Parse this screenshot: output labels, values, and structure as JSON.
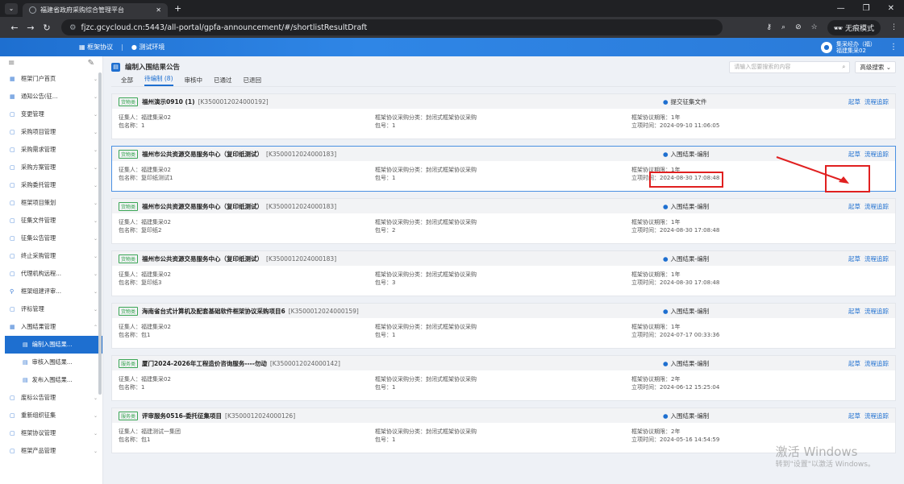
{
  "browser": {
    "tab_title": "福建省政府采购综合管理平台",
    "site_icon": "tune-icon",
    "url": "fjzc.gcycloud.cn:5443/all-portal/gpfa-announcement/#/shortlistResultDraft",
    "incognito_label": "无痕模式"
  },
  "appbar": {
    "item1": "框架协议",
    "item2": "测试环境",
    "user_line1": "集采经办（福）",
    "user_line2": "福建集采02"
  },
  "sidebar": {
    "items": [
      {
        "label": "框架门户首页",
        "icon": "grid-icon"
      },
      {
        "label": "通知公告(征...",
        "icon": "grid-icon"
      },
      {
        "label": "变更管理",
        "icon": "doc-icon"
      },
      {
        "label": "采购项目管理",
        "icon": "doc-icon"
      },
      {
        "label": "采购需求管理",
        "icon": "doc-icon"
      },
      {
        "label": "采购方案管理",
        "icon": "doc-icon"
      },
      {
        "label": "采购委托管理",
        "icon": "doc-icon"
      },
      {
        "label": "框架项目策划",
        "icon": "doc-icon"
      },
      {
        "label": "征集文件管理",
        "icon": "doc-icon"
      },
      {
        "label": "征集公告管理",
        "icon": "doc-icon"
      },
      {
        "label": "终止采购管理",
        "icon": "doc-icon"
      },
      {
        "label": "代理机构远程...",
        "icon": "doc-icon"
      },
      {
        "label": "框架组建评审...",
        "icon": "user-icon"
      },
      {
        "label": "评标管理",
        "icon": "doc-icon"
      },
      {
        "label": "入围结果管理",
        "icon": "grid-icon"
      }
    ],
    "sub_items": [
      {
        "label": "编制入围结果..."
      },
      {
        "label": "审核入围结果..."
      },
      {
        "label": "发布入围结果..."
      }
    ],
    "items_after": [
      {
        "label": "废标公告管理"
      },
      {
        "label": "重新组织征集"
      },
      {
        "label": "框架协议管理"
      },
      {
        "label": "框架产品管理"
      }
    ]
  },
  "page": {
    "title": "编制入围结果公告",
    "search_placeholder": "请输入您要搜索的内容",
    "advanced_search": "高级搜索",
    "tabs": [
      "全部",
      "待编制 (8)",
      "审核中",
      "已通过",
      "已退回"
    ]
  },
  "cards": [
    {
      "tag": "货物类",
      "name": "福州演示0910 (1)",
      "no": "[K3500012024000192]",
      "status": "提交征集文件",
      "actions": [
        "起草",
        "流程追踪"
      ],
      "c1a": "征集人：福建集采02",
      "c1b": "包名称：1",
      "c2a": "框架协议采购分类：封闭式框架协议采购",
      "c2b": "包号：1",
      "c3a": "框架协议期限：1年",
      "c3b": "立项时间：2024-09-10 11:06:05"
    },
    {
      "tag": "货物类",
      "name": "福州市公共资源交易服务中心（复印纸测试）",
      "no": "[K3500012024000183]",
      "status": "入围结果-编制",
      "actions": [
        "起草",
        "流程追踪"
      ],
      "c1a": "征集人：福建集采02",
      "c1b": "包名称：复印纸测试1",
      "c2a": "框架协议采购分类：封闭式框架协议采购",
      "c2b": "包号：1",
      "c3a": "框架协议期限：1年",
      "c3b": "立项时间：2024-08-30 17:08:48"
    },
    {
      "tag": "货物类",
      "name": "福州市公共资源交易服务中心（复印纸测试）",
      "no": "[K3500012024000183]",
      "status": "入围结果-编制",
      "actions": [
        "起草",
        "流程追踪"
      ],
      "c1a": "征集人：福建集采02",
      "c1b": "包名称：复印纸2",
      "c2a": "框架协议采购分类：封闭式框架协议采购",
      "c2b": "包号：2",
      "c3a": "框架协议期限：1年",
      "c3b": "立项时间：2024-08-30 17:08:48"
    },
    {
      "tag": "货物类",
      "name": "福州市公共资源交易服务中心（复印纸测试）",
      "no": "[K3500012024000183]",
      "status": "入围结果-编制",
      "actions": [
        "起草",
        "流程追踪"
      ],
      "c1a": "征集人：福建集采02",
      "c1b": "包名称：复印纸3",
      "c2a": "框架协议采购分类：封闭式框架协议采购",
      "c2b": "包号：3",
      "c3a": "框架协议期限：1年",
      "c3b": "立项时间：2024-08-30 17:08:48"
    },
    {
      "tag": "货物类",
      "name": "海南省台式计算机及配套基础软件框架协议采购项目6",
      "no": "[K3500012024000159]",
      "status": "入围结果-编制",
      "actions": [
        "起草",
        "流程追踪"
      ],
      "c1a": "征集人：福建集采02",
      "c1b": "包名称：包1",
      "c2a": "框架协议采购分类：封闭式框架协议采购",
      "c2b": "包号：1",
      "c3a": "框架协议期限：1年",
      "c3b": "立项时间：2024-07-17 00:33:36"
    },
    {
      "tag": "服务类",
      "name": "厦门2024-2026年工程造价咨询服务----勿动",
      "no": "[K3500012024000142]",
      "status": "入围结果-编制",
      "actions": [
        "起草",
        "流程追踪"
      ],
      "c1a": "征集人：福建集采02",
      "c1b": "包名称：1",
      "c2a": "框架协议采购分类：封闭式框架协议采购",
      "c2b": "包号：1",
      "c3a": "框架协议期限：2年",
      "c3b": "立项时间：2024-06-12 15:25:04"
    },
    {
      "tag": "服务类",
      "name": "评审服务0516-委托征集项目",
      "no": "[K3500012024000126]",
      "status": "入围结果-编制",
      "actions": [
        "起草",
        "流程追踪"
      ],
      "c1a": "征集人：福建测试一集团",
      "c1b": "包名称：包1",
      "c2a": "框架协议采购分类：封闭式框架协议采购",
      "c2b": "包号：1",
      "c3a": "框架协议期限：2年",
      "c3b": "立项时间：2024-05-16 14:54:59"
    }
  ],
  "watermark": {
    "line1": "激活 Windows",
    "line2": "转到\"设置\"以激活 Windows。"
  }
}
